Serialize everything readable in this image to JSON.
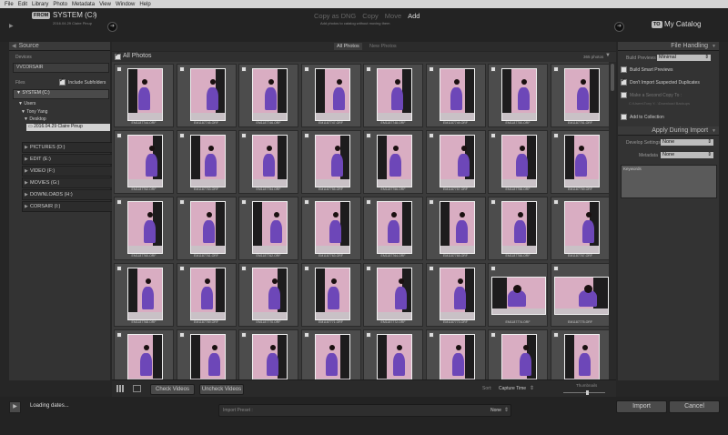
{
  "menubar": [
    "File",
    "Edit",
    "Library",
    "Photo",
    "Metadata",
    "View",
    "Window",
    "Help"
  ],
  "topbar": {
    "from_pill": "FROM",
    "from_source": "SYSTEM (C:)",
    "from_path": "2016.04.29 Claire Pinup",
    "modes": [
      "Copy as DNG",
      "Copy",
      "Move",
      "Add"
    ],
    "mode_subtitle": "Add photos to catalog without moving them",
    "to_pill": "TO",
    "to_target": "My Catalog"
  },
  "source": {
    "title": "Source",
    "devices_label": "Devices",
    "device_name": "VVCORSAIR",
    "files_label": "Files",
    "include_subfolders": "Include Subfolders",
    "drive": "SYSTEM (C:)",
    "folders": [
      "Users",
      "Tony Yang",
      "Desktop"
    ],
    "selected_folder": "2016.04.29 Claire Pinup",
    "other_drives": [
      "PICTURES (D:)",
      "EDIT (E:)",
      "VIDEO (F:)",
      "MOVIES (G:)",
      "DOWNLOADS (H:)",
      "CORSAIR (I:)"
    ]
  },
  "grid": {
    "tabs": [
      "All Photos",
      "New Photos"
    ],
    "header_label": "All Photos",
    "count_text": "365 photos",
    "thumbnails": [
      "EM1187744.ORF",
      "EM1187745.ORF",
      "EM1187746.ORF",
      "EM1187747.ORF",
      "EM1187748.ORF",
      "EM1187749.ORF",
      "EM1187750.ORF",
      "EM1187751.ORF",
      "EM1187752.ORF",
      "EM1187753.ORF",
      "EM1187754.ORF",
      "EM1187755.ORF",
      "EM1187756.ORF",
      "EM1187757.ORF",
      "EM1187758.ORF",
      "EM1187759.ORF",
      "EM1187760.ORF",
      "EM1187761.ORF",
      "EM1187762.ORF",
      "EM1187763.ORF",
      "EM1187764.ORF",
      "EM1187765.ORF",
      "EM1187766.ORF",
      "EM1187767.ORF",
      "EM1187768.ORF",
      "EM1187769.ORF",
      "EM1187770.ORF",
      "EM1187771.ORF",
      "EM1187772.ORF",
      "EM1187773.ORF",
      "EM1187774.ORF",
      "EM1187775.ORF",
      "EM1187776.ORF",
      "EM1187777.ORF",
      "EM1187778.ORF",
      "EM1187779.ORF",
      "EM1187780.ORF",
      "EM1187781.ORF",
      "EM1187782.ORF",
      "EM1187783.ORF"
    ]
  },
  "toolbar": {
    "check_all": "Check Videos",
    "uncheck_all": "Uncheck Videos",
    "sort_label": "Sort:",
    "sort_value": "Capture Time",
    "thumbnails_label": "Thumbnails"
  },
  "file_handling": {
    "title": "File Handling",
    "build_previews_label": "Build Previews",
    "build_previews_value": "Minimal",
    "smart_previews": "Build Smart Previews",
    "no_duplicates": "Don't Import Suspected Duplicates",
    "second_copy": "Make a Second Copy To :",
    "second_copy_path": "C:\\Users\\Tony Y...\\Download Backups",
    "add_collection": "Add to Collection"
  },
  "apply_during_import": {
    "title": "Apply During Import",
    "develop_label": "Develop Settings",
    "develop_value": "None",
    "metadata_label": "Metadata",
    "metadata_value": "None",
    "keywords_label": "Keywords"
  },
  "bottom": {
    "status": "Loading dates...",
    "preset_label": "Import Preset :",
    "preset_value": "None",
    "import": "Import",
    "cancel": "Cancel"
  },
  "colors": {
    "accent": "#d9adc2",
    "dress": "#6d47b8",
    "panel": "#333333"
  }
}
